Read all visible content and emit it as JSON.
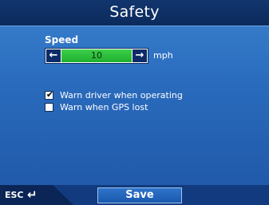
{
  "header": {
    "title": "Safety"
  },
  "speed": {
    "label": "Speed",
    "value": "10",
    "unit": "mph",
    "decrease_icon": "arrow-left-icon",
    "increase_icon": "arrow-right-icon"
  },
  "options": [
    {
      "label": "Warn driver when operating",
      "checked": true
    },
    {
      "label": "Warn when GPS lost",
      "checked": false
    }
  ],
  "footer": {
    "esc_label": "ESC",
    "esc_icon": "return-arrow-icon",
    "save_label": "Save"
  },
  "colors": {
    "title_bar": "#0b2a5c",
    "background": "#2a6bbd",
    "spin_value": "#1fae2e",
    "spin_buttons": "#0c2c68"
  }
}
